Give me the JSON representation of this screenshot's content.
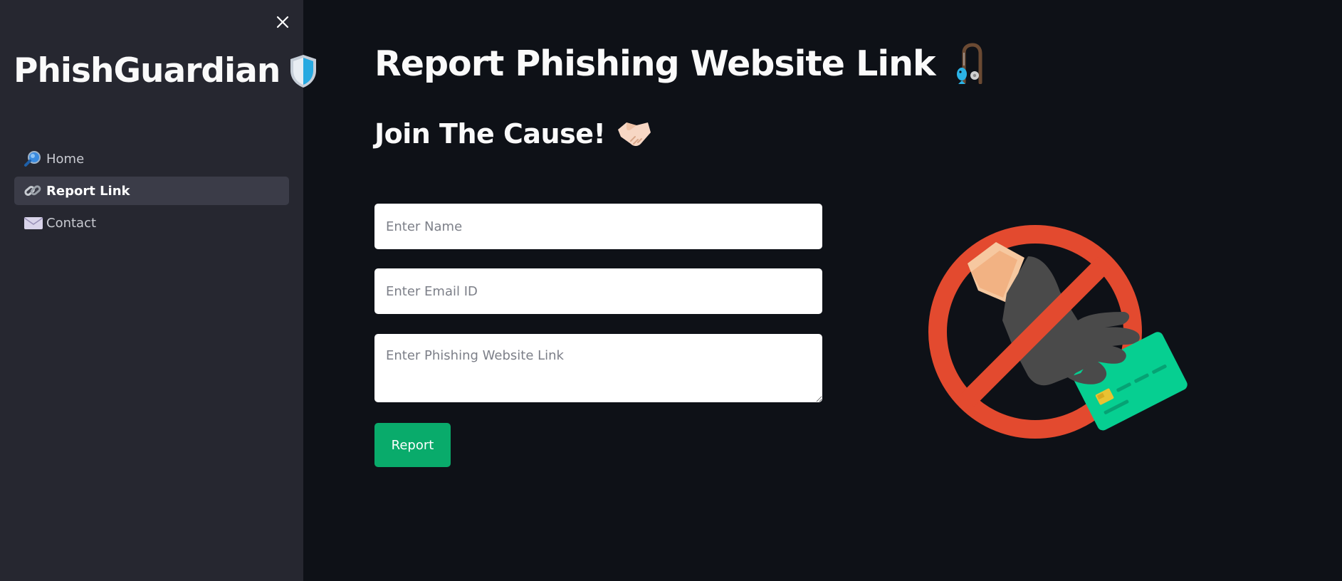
{
  "sidebar": {
    "app_title": "PhishGuardian",
    "title_icon": "shield-icon",
    "close_icon": "close-icon",
    "items": [
      {
        "label": "Home",
        "icon": "magnifier-icon",
        "active": false
      },
      {
        "label": "Report Link",
        "icon": "link-icon",
        "active": true
      },
      {
        "label": "Contact",
        "icon": "envelope-icon",
        "active": false
      }
    ]
  },
  "main": {
    "title": "Report Phishing Website Link",
    "title_icon": "fishing-icon",
    "subtitle": "Join The Cause!",
    "subtitle_icon": "handshake-icon",
    "form": {
      "name_placeholder": "Enter Name",
      "email_placeholder": "Enter Email ID",
      "link_placeholder": "Enter Phishing Website Link",
      "submit_label": "Report"
    },
    "illustration": "no-card-theft-icon"
  },
  "colors": {
    "sidebar_bg": "#262730",
    "main_bg": "#0e1117",
    "active_nav_bg": "#3b3c48",
    "button": "#09ab6b",
    "prohibit_red": "#e34a2f",
    "card_green": "#06cf91"
  }
}
